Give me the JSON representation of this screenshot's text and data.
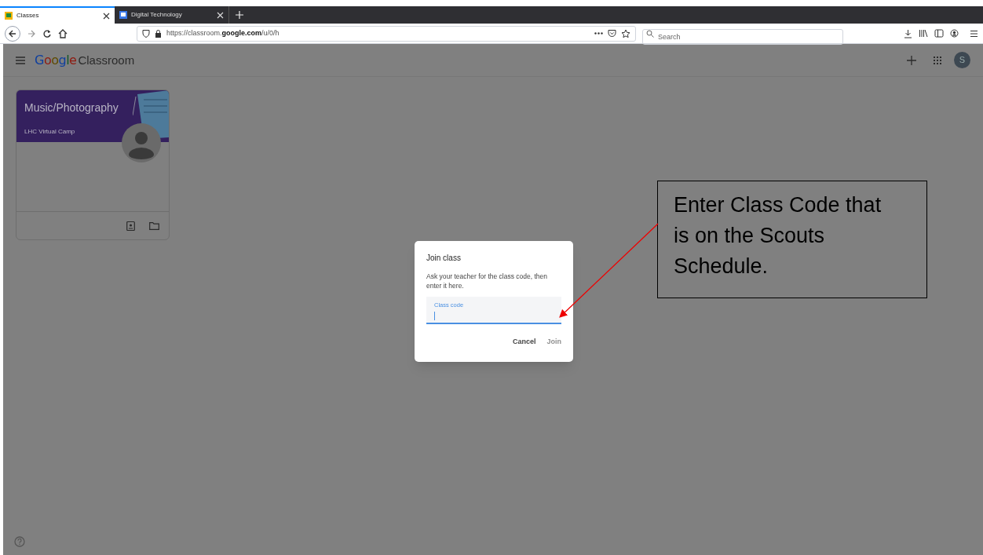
{
  "browser": {
    "tabs": [
      {
        "title": "Classes",
        "selected": true
      },
      {
        "title": "Digital Technology",
        "selected": false
      }
    ],
    "url_prefix": "https://classroom.",
    "url_domain": "google.com",
    "url_path": "/u/0/h",
    "search": {
      "placeholder": "Search"
    }
  },
  "app": {
    "logo_google": "Google",
    "logo_product": "Classroom",
    "avatar_letter": "S"
  },
  "cards": [
    {
      "title": "Music/Photography",
      "subtitle": "LHC Virtual Camp"
    }
  ],
  "dialog": {
    "title": "Join class",
    "text": "Ask your teacher for the class code, then enter it here.",
    "field": {
      "label": "Class code"
    },
    "buttons": [
      {
        "label": "Cancel",
        "disabled": false
      },
      {
        "label": "Join",
        "disabled": true
      }
    ]
  },
  "annotation": {
    "text": "Enter Class Code that is on the Scouts Schedule."
  }
}
